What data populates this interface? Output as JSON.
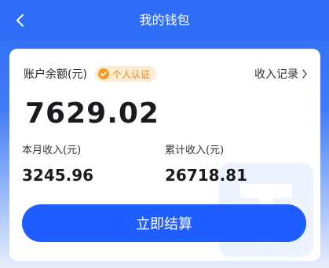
{
  "header": {
    "title": "我的钱包",
    "back_icon": "chevron-left-icon"
  },
  "wallet": {
    "balance_label": "账户余额(元)",
    "badge_text": "个人认证",
    "badge_icon": "check-circle-icon",
    "income_link": "收入记录",
    "balance_value": "7629.02",
    "month_label": "本月收入(元)",
    "month_value": "3245.96",
    "total_label": "累计收入(元)",
    "total_value": "26718.81",
    "settle_button": "立即结算"
  },
  "colors": {
    "header_bg": "#2f6df6",
    "button_bg": "#1f5dff",
    "badge_bg": "#fdebd2",
    "badge_text": "#e08a1e"
  }
}
